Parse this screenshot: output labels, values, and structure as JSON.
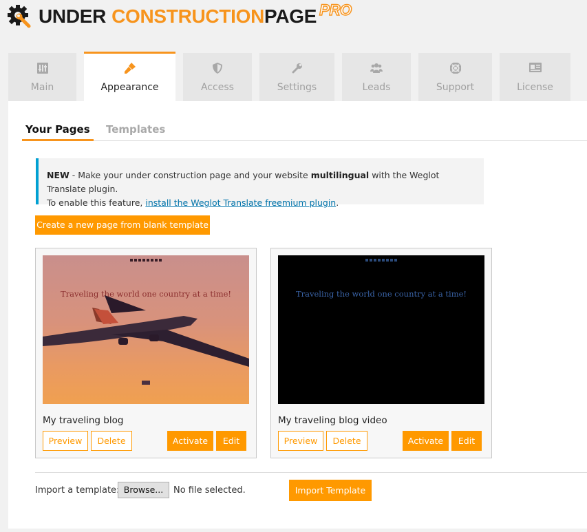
{
  "brand": {
    "word1": "UNDER",
    "word2": "CONSTRUCTION",
    "word3": "PAGE",
    "badge": "PRO",
    "accent_color": "#f7941d"
  },
  "tabs": [
    {
      "label": "Main",
      "icon": "sliders-icon",
      "active": false
    },
    {
      "label": "Appearance",
      "icon": "paint-brush-icon",
      "active": true
    },
    {
      "label": "Access",
      "icon": "shield-icon",
      "active": false
    },
    {
      "label": "Settings",
      "icon": "wrench-icon",
      "active": false
    },
    {
      "label": "Leads",
      "icon": "users-icon",
      "active": false
    },
    {
      "label": "Support",
      "icon": "life-ring-icon",
      "active": false
    },
    {
      "label": "License",
      "icon": "id-card-icon",
      "active": false
    }
  ],
  "subtabs": {
    "your_pages": "Your Pages",
    "templates": "Templates"
  },
  "notice": {
    "new": "NEW",
    "part1": " - Make your under construction page and your website ",
    "bold": "multilingual",
    "part2": " with the Weglot Translate plugin.",
    "line2": "To enable this feature, ",
    "link": "install the Weglot Translate freemium plugin",
    "end": "."
  },
  "create_button": "Create a new page from blank template",
  "cards": [
    {
      "title": "My traveling blog",
      "thumb_text": "Traveling  the  world  one country  at  a  time!",
      "preview": "Preview",
      "delete": "Delete",
      "activate": "Activate",
      "edit": "Edit"
    },
    {
      "title": "My traveling blog video",
      "thumb_text": "Traveling  the  world  one country  at  a  time!",
      "preview": "Preview",
      "delete": "Delete",
      "activate": "Activate",
      "edit": "Edit"
    }
  ],
  "import": {
    "label": "Import a template:",
    "browse": "Browse...",
    "file_status": "No file selected.",
    "button": "Import Template"
  }
}
